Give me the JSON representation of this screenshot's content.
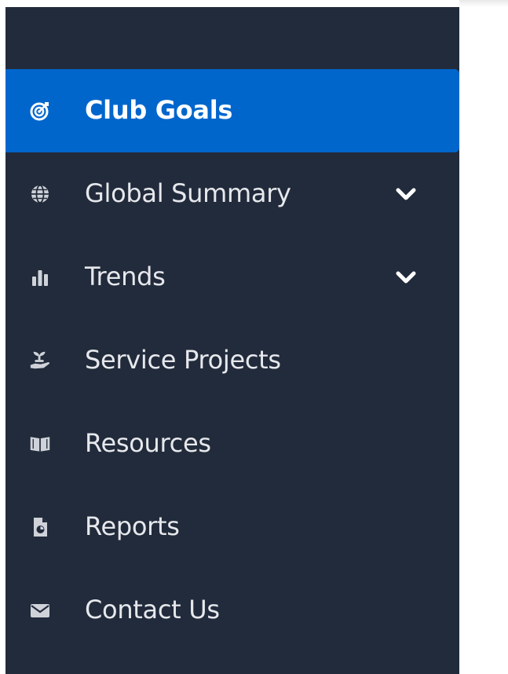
{
  "colors": {
    "sidebar_bg": "#222b3b",
    "active_bg": "#0066cc",
    "text": "#e6e8ec",
    "icon": "#cfd3d9"
  },
  "sidebar": {
    "items": [
      {
        "label": "Club Goals",
        "icon": "target-icon",
        "active": true,
        "expandable": false
      },
      {
        "label": "Global Summary",
        "icon": "globe-icon",
        "active": false,
        "expandable": true
      },
      {
        "label": "Trends",
        "icon": "bar-chart-icon",
        "active": false,
        "expandable": true
      },
      {
        "label": "Service Projects",
        "icon": "hand-seedling-icon",
        "active": false,
        "expandable": false
      },
      {
        "label": "Resources",
        "icon": "book-open-icon",
        "active": false,
        "expandable": false
      },
      {
        "label": "Reports",
        "icon": "file-chart-icon",
        "active": false,
        "expandable": false
      },
      {
        "label": "Contact Us",
        "icon": "envelope-icon",
        "active": false,
        "expandable": false
      }
    ]
  }
}
